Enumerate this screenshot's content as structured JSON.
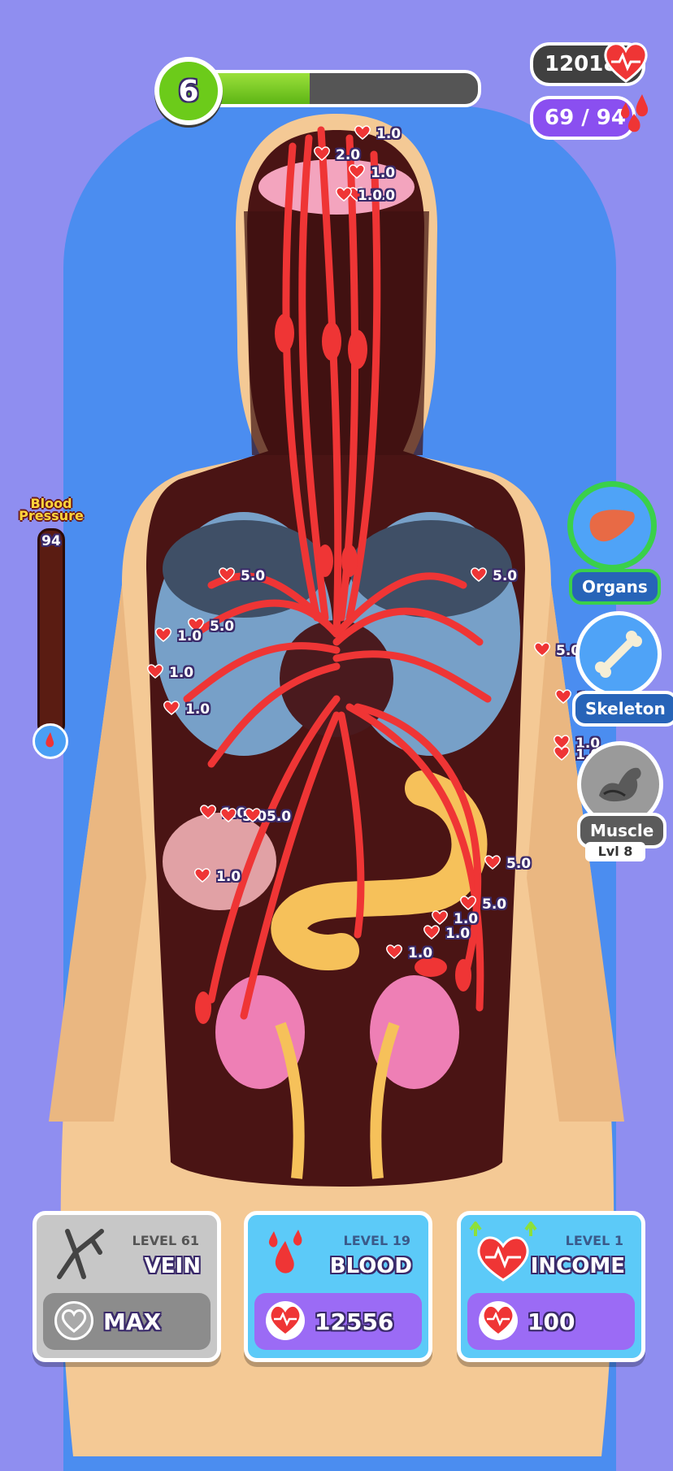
{
  "hud": {
    "level": "6",
    "progress": 0.38,
    "hearts": "120182",
    "drops": "69 / 94"
  },
  "blood_pressure": {
    "label_line1": "Blood",
    "label_line2": "Pressure",
    "value": "94"
  },
  "categories": [
    {
      "label": "Organs",
      "icon": "liver-icon",
      "state": "active"
    },
    {
      "label": "Skeleton",
      "icon": "bone-icon",
      "state": "available"
    },
    {
      "label": "Muscle",
      "icon": "muscle-icon",
      "state": "locked",
      "level": "Lvl 8"
    }
  ],
  "floating_values": [
    {
      "text": "1.0"
    },
    {
      "text": "2.0"
    },
    {
      "text": "1.0"
    },
    {
      "text": "1.0"
    },
    {
      "text": "1.0"
    },
    {
      "text": "5.0"
    },
    {
      "text": "5.0"
    },
    {
      "text": "5.0"
    },
    {
      "text": "1.0"
    },
    {
      "text": "1.0"
    },
    {
      "text": "1.0"
    },
    {
      "text": "5.0"
    },
    {
      "text": "1.0"
    },
    {
      "text": "1.0"
    },
    {
      "text": "1.0"
    },
    {
      "text": "1.0"
    },
    {
      "text": "5.0"
    },
    {
      "text": "5.0"
    },
    {
      "text": "1.0"
    },
    {
      "text": "5.0"
    },
    {
      "text": "5.0"
    },
    {
      "text": "1.0"
    },
    {
      "text": "1.0"
    },
    {
      "text": "1.0"
    }
  ],
  "upgrades": [
    {
      "level": "LEVEL 61",
      "name": "VEIN",
      "cost": "MAX",
      "icon": "vein-icon"
    },
    {
      "level": "LEVEL 19",
      "name": "BLOOD",
      "cost": "12556",
      "icon": "blood-drops-icon"
    },
    {
      "level": "LEVEL 1",
      "name": "INCOME",
      "cost": "100",
      "icon": "heart-monitor-icon"
    }
  ],
  "colors": {
    "background": "#8f8ef0",
    "progress_green": "#6ccb1a",
    "organs_active": "#3ad04a",
    "vein_red": "#ef3535",
    "purple": "#9b6bf5",
    "cyan_card": "#5ccaf8"
  }
}
